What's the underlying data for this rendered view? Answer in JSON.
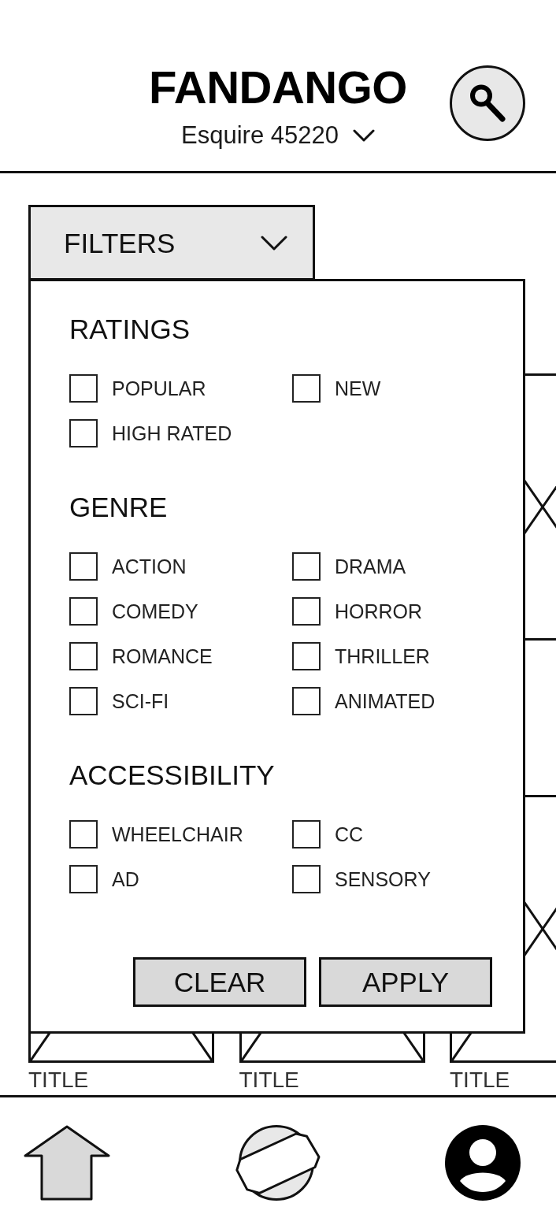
{
  "header": {
    "title": "FANDANGO",
    "location": "Esquire 45220"
  },
  "filters": {
    "label": "FILTERS",
    "expanded": true,
    "sections": [
      {
        "title": "RATINGS",
        "options": [
          {
            "label": "POPULAR",
            "checked": false
          },
          {
            "label": "NEW",
            "checked": false
          },
          {
            "label": "HIGH RATED",
            "checked": false
          }
        ]
      },
      {
        "title": "GENRE",
        "options": [
          {
            "label": "ACTION",
            "checked": false
          },
          {
            "label": "DRAMA",
            "checked": false
          },
          {
            "label": "COMEDY",
            "checked": false
          },
          {
            "label": "HORROR",
            "checked": false
          },
          {
            "label": "ROMANCE",
            "checked": false
          },
          {
            "label": "THRILLER",
            "checked": false
          },
          {
            "label": "SCI-FI",
            "checked": false
          },
          {
            "label": "ANIMATED",
            "checked": false
          }
        ]
      },
      {
        "title": "ACCESSIBILITY",
        "options": [
          {
            "label": "WHEELCHAIR",
            "checked": false
          },
          {
            "label": "CC",
            "checked": false
          },
          {
            "label": "AD",
            "checked": false
          },
          {
            "label": "SENSORY",
            "checked": false
          }
        ]
      }
    ],
    "buttons": [
      {
        "label": "CLEAR"
      },
      {
        "label": "APPLY"
      }
    ]
  },
  "movies": [
    {
      "title": "TITLE"
    },
    {
      "title": "TITLE"
    },
    {
      "title": "TITLE"
    }
  ]
}
